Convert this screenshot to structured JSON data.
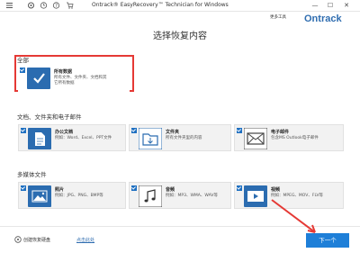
{
  "window": {
    "title": "Ontrack® EasyRecovery™ Technician for Windows",
    "minimize": "—",
    "maximize": "☐",
    "close": "✕"
  },
  "toolbar": {
    "more_tools": "更多工具",
    "brand": "Ontrack",
    "icons": [
      "menu-icon",
      "settings-icon",
      "clock-icon",
      "help-icon",
      "cart-icon"
    ]
  },
  "page": {
    "title": "选择恢复内容"
  },
  "sections": {
    "all": {
      "label": "全部",
      "card": {
        "title": "所有数据",
        "desc_line1": "所有文件、文件夹、文档和其",
        "desc_line2": "它所有数据",
        "checked": true
      }
    },
    "docs": {
      "label": "文档、文件夹和电子邮件",
      "cards": [
        {
          "title": "办公文档",
          "desc": "例如：Word、Excel、PPT文件",
          "icon": "document-icon",
          "checked": true
        },
        {
          "title": "文件夹",
          "desc": "所有文件夹里的内容",
          "icon": "folder-icon",
          "checked": true
        },
        {
          "title": "电子邮件",
          "desc": "包含MS Outlook电子邮件",
          "icon": "email-icon",
          "checked": true
        }
      ]
    },
    "media": {
      "label": "多媒体文件",
      "cards": [
        {
          "title": "照片",
          "desc": "例如：JPG、PNG、BMP等",
          "icon": "photo-icon",
          "checked": true
        },
        {
          "title": "音频",
          "desc": "例如：MP3、WMA、WAV等",
          "icon": "audio-icon",
          "checked": true
        },
        {
          "title": "视频",
          "desc": "例如：MPEG、MOV、FLV等",
          "icon": "video-icon",
          "checked": true
        }
      ]
    }
  },
  "footer": {
    "create_disk": "创建恢复硬盘",
    "click_here": "点击此处",
    "next_button": "下一个"
  },
  "colors": {
    "accent": "#1f70c1",
    "highlight": "#e53935",
    "brand": "#2f6db0"
  }
}
